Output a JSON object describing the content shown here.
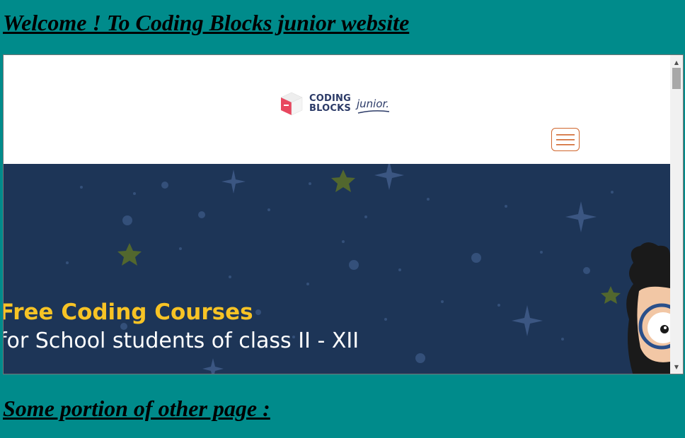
{
  "page": {
    "heading": "Welcome ! To Coding Blocks junior website",
    "section_heading": "Some portion of other page :"
  },
  "embedded_site": {
    "logo": {
      "line1": "CODING",
      "line2": "BLOCKS",
      "junior": "junior."
    },
    "hero": {
      "title": "Free Coding Courses",
      "subtitle": "for School students of class II - XII"
    }
  },
  "colors": {
    "page_background": "#008b8b",
    "hero_background": "#1d3557",
    "hero_title": "#f7c325",
    "menu_border": "#d0662d",
    "logo_red": "#e8475f",
    "logo_navy": "#2b3a67"
  },
  "icons": {
    "menu": "hamburger-menu-icon",
    "scroll_up": "arrow-up-icon",
    "scroll_down": "arrow-down-icon"
  }
}
